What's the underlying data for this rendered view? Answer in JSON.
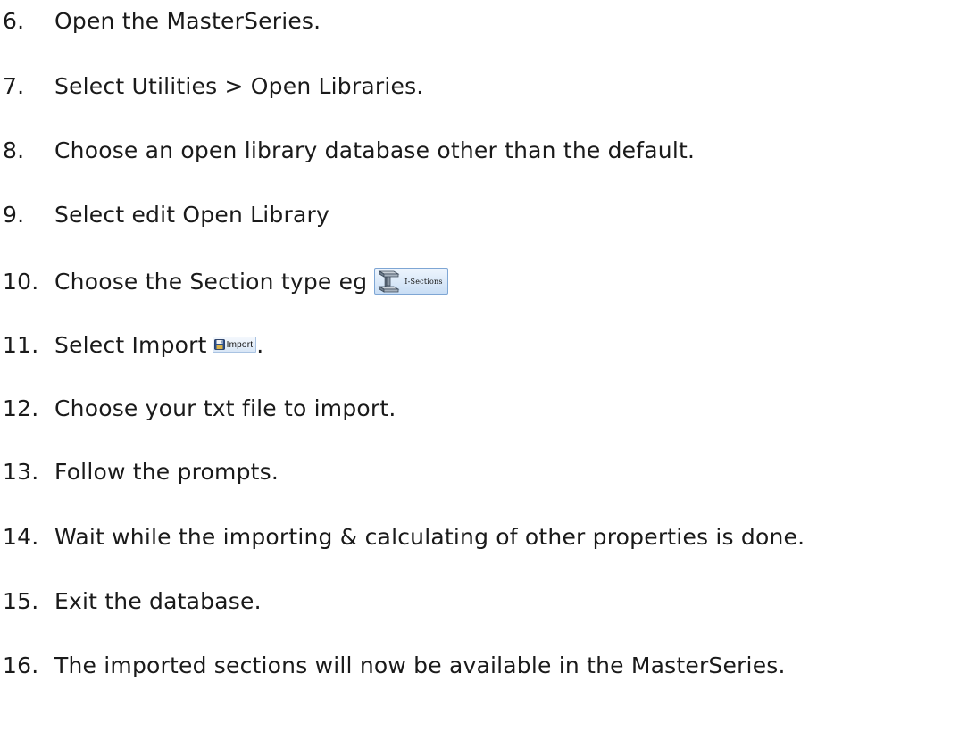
{
  "steps": [
    {
      "num": "6.",
      "text": "Open the MasterSeries."
    },
    {
      "num": "7.",
      "text": "Select Utilities > Open Libraries."
    },
    {
      "num": "8.",
      "text": "Choose an open library database other than the default."
    },
    {
      "num": "9.",
      "text": "Select edit Open Library"
    },
    {
      "num": "10.",
      "text": "Choose the Section type eg"
    },
    {
      "num": "11.",
      "text": "Select Import",
      "suffix": "."
    },
    {
      "num": "12.",
      "text": "Choose your txt file to import."
    },
    {
      "num": "13.",
      "text": "Follow the prompts."
    },
    {
      "num": "14.",
      "text": "Wait while the importing & calculating of other properties is done."
    },
    {
      "num": "15.",
      "text": "Exit the database."
    },
    {
      "num": "16.",
      "text": "The imported sections will now be available in the MasterSeries."
    }
  ],
  "buttons": {
    "isections": {
      "label": "I-Sections",
      "icon": "i-beam-icon"
    },
    "import": {
      "label": "Import",
      "icon": "floppy-disk-icon"
    }
  },
  "colors": {
    "text": "#1a1a1a",
    "button_border": "#7ea6d4",
    "button_fill_top": "#eef5fd",
    "button_fill_bottom": "#c9def5"
  }
}
